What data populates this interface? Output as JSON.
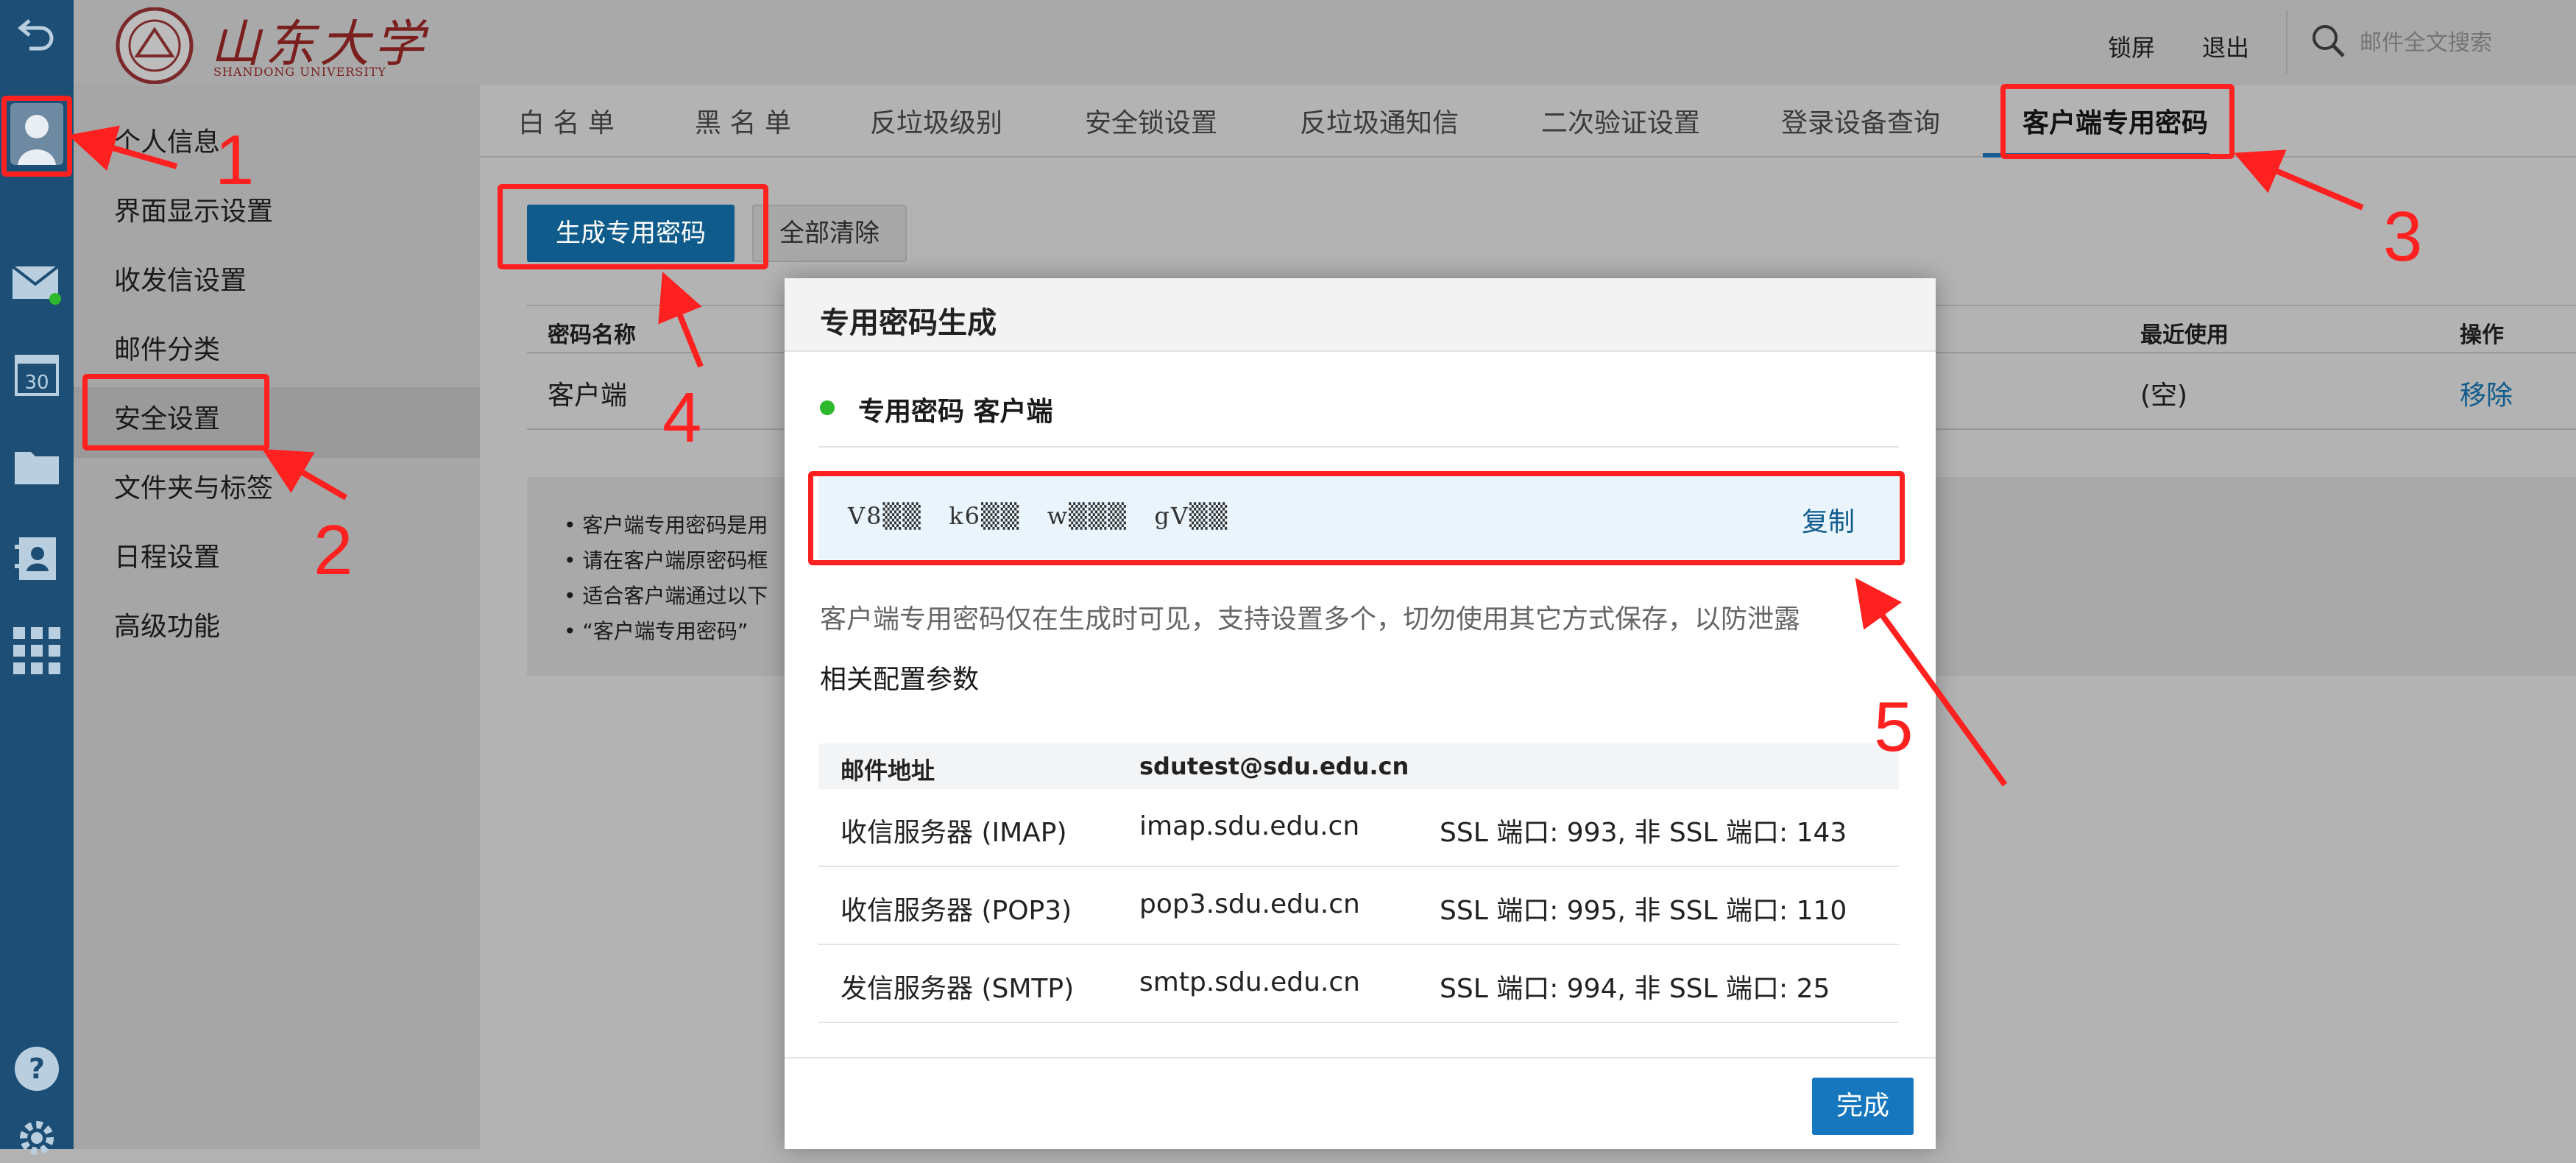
{
  "header": {
    "logo_text": "山东大学",
    "logo_subtext": "SHANDONG UNIVERSITY",
    "lock_label": "锁屏",
    "logout_label": "退出",
    "search_placeholder": "邮件全文搜索"
  },
  "rail": {
    "icons": [
      "back-icon",
      "avatar-icon",
      "mail-icon",
      "calendar-icon",
      "folder-icon",
      "contacts-icon",
      "apps-icon",
      "help-icon",
      "gear-icon"
    ],
    "calendar_day": "30"
  },
  "nav": {
    "items": [
      {
        "label": "个人信息"
      },
      {
        "label": "界面显示设置"
      },
      {
        "label": "收发信设置"
      },
      {
        "label": "邮件分类"
      },
      {
        "label": "安全设置",
        "active": true
      },
      {
        "label": "文件夹与标签"
      },
      {
        "label": "日程设置"
      },
      {
        "label": "高级功能"
      }
    ]
  },
  "tabs": [
    {
      "label": "白 名 单"
    },
    {
      "label": "黑 名 单"
    },
    {
      "label": "反垃圾级别"
    },
    {
      "label": "安全锁设置"
    },
    {
      "label": "反垃圾通知信"
    },
    {
      "label": "二次验证设置"
    },
    {
      "label": "登录设备查询"
    },
    {
      "label": "客户端专用密码",
      "active": true
    }
  ],
  "toolbar": {
    "generate_label": "生成专用密码",
    "clear_label": "全部清除"
  },
  "table": {
    "headers": {
      "name": "密码名称",
      "recent": "最近使用",
      "action": "操作"
    },
    "rows": [
      {
        "name": "客户端",
        "recent": "(空)",
        "action": "移除"
      }
    ]
  },
  "notice": {
    "lines": [
      "• 客户端专用密码是用",
      "• 请在客户端原密码框",
      "• 适合客户端通过以下",
      "• “客户端专用密码”"
    ]
  },
  "dialog": {
    "title": "专用密码生成",
    "subtitle": "专用密码 客户端",
    "password_masked": "V8▒▒   k6▒▒   w▒▒▒   gV▒▒",
    "copy_label": "复制",
    "hint": "客户端专用密码仅在生成时可见，支持设置多个，切勿使用其它方式保存，以防泄露",
    "config_title": "相关配置参数",
    "config": {
      "header": {
        "label": "邮件地址",
        "value": "sdutest@sdu.edu.cn"
      },
      "rows": [
        {
          "label": "收信服务器 (IMAP)",
          "host": "imap.sdu.edu.cn",
          "ports": "SSL 端口: 993, 非 SSL 端口: 143"
        },
        {
          "label": "收信服务器 (POP3)",
          "host": "pop3.sdu.edu.cn",
          "ports": "SSL 端口: 995, 非 SSL 端口: 110"
        },
        {
          "label": "发信服务器 (SMTP)",
          "host": "smtp.sdu.edu.cn",
          "ports": "SSL 端口: 994, 非 SSL 端口: 25"
        }
      ]
    },
    "done_label": "完成"
  },
  "annotations": {
    "numbers": [
      "1",
      "2",
      "3",
      "4",
      "5"
    ],
    "color": "#ff2020"
  },
  "colors": {
    "rail": "#1d4f76",
    "accent": "#0f5c8c",
    "done_button": "#1677be",
    "status_dot": "#2db82d"
  }
}
